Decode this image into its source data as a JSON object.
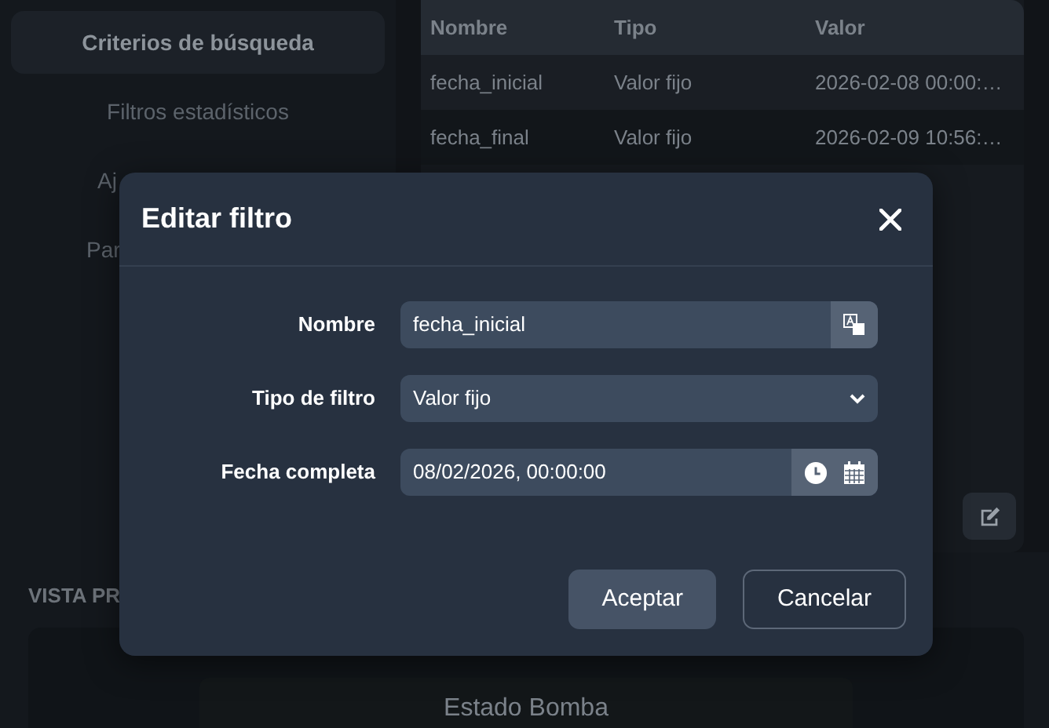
{
  "sidebar": {
    "items": [
      {
        "label": "Criterios de búsqueda",
        "selected": true
      },
      {
        "label": "Filtros estadísticos",
        "selected": false
      },
      {
        "label": "Aj",
        "selected": false
      },
      {
        "label": "Par",
        "selected": false
      }
    ]
  },
  "table": {
    "columns": [
      "Nombre",
      "Tipo",
      "Valor"
    ],
    "rows": [
      [
        "fecha_inicial",
        "Valor fijo",
        "2026-02-08 00:00:…"
      ],
      [
        "fecha_final",
        "Valor fijo",
        "2026-02-09 10:56:…"
      ]
    ]
  },
  "preview": {
    "heading": "VISTA PR",
    "card_title": "Estado Bomba"
  },
  "modal": {
    "title": "Editar filtro",
    "fields": [
      {
        "kind": "text",
        "label": "Nombre",
        "value": "fecha_inicial"
      },
      {
        "kind": "select",
        "label": "Tipo de filtro",
        "value": "Valor fijo"
      },
      {
        "kind": "datetime",
        "label": "Fecha completa",
        "value": "08/02/2026, 00:00:00"
      }
    ],
    "buttons": [
      {
        "label": "Aceptar",
        "kind": "primary"
      },
      {
        "label": "Cancelar",
        "kind": "outline"
      }
    ]
  }
}
